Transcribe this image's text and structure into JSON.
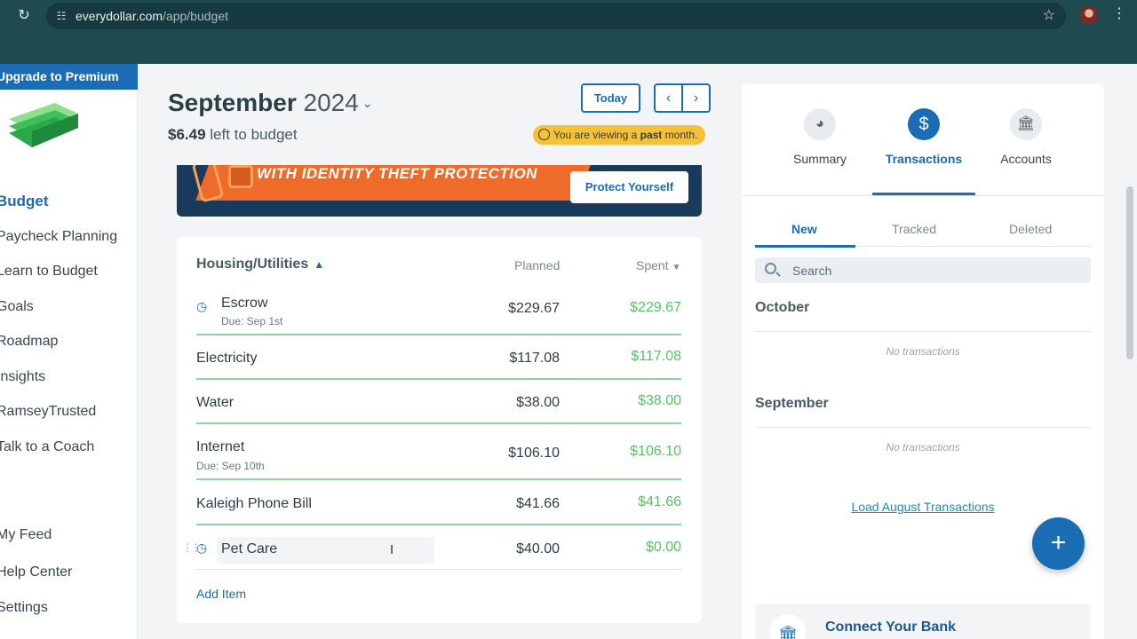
{
  "browser": {
    "url_host": "everydollar.com",
    "url_path": "/app/budget"
  },
  "sidebar": {
    "premium_label": "Upgrade to Premium",
    "items": [
      {
        "label": "Budget"
      },
      {
        "label": "Paycheck Planning"
      },
      {
        "label": "Learn to Budget"
      },
      {
        "label": "Goals"
      },
      {
        "label": "Roadmap"
      },
      {
        "label": "Insights"
      },
      {
        "label": "RamseyTrusted"
      },
      {
        "label": "Talk to a Coach"
      },
      {
        "label": "My Feed"
      },
      {
        "label": "Help Center"
      },
      {
        "label": "Settings"
      }
    ]
  },
  "header": {
    "month": "September",
    "year": "2024",
    "left_amount": "$6.49",
    "left_label": "left to budget",
    "today_label": "Today",
    "past_prefix": "You are viewing a ",
    "past_word": "past",
    "past_suffix": " month."
  },
  "banner": {
    "text": "WITH IDENTITY THEFT PROTECTION",
    "button_label": "Protect Yourself"
  },
  "budget_group": {
    "title": "Housing/Utilities",
    "planned_header": "Planned",
    "spent_header": "Spent",
    "add_item_label": "Add Item",
    "rows": [
      {
        "name": "Escrow",
        "due": "Due: Sep 1st",
        "planned": "$229.67",
        "spent": "$229.67"
      },
      {
        "name": "Electricity",
        "planned": "$117.08",
        "spent": "$117.08"
      },
      {
        "name": "Water",
        "planned": "$38.00",
        "spent": "$38.00"
      },
      {
        "name": "Internet",
        "due": "Due: Sep 10th",
        "planned": "$106.10",
        "spent": "$106.10"
      },
      {
        "name": "Kaleigh Phone Bill",
        "planned": "$41.66",
        "spent": "$41.66"
      },
      {
        "name": "Pet Care",
        "planned": "$40.00",
        "spent": "$0.00"
      }
    ]
  },
  "panel": {
    "tabs": [
      {
        "label": "Summary",
        "icon": "pie-chart-icon"
      },
      {
        "label": "Transactions",
        "icon": "dollar-icon"
      },
      {
        "label": "Accounts",
        "icon": "bank-icon"
      }
    ],
    "subtabs": [
      {
        "label": "New"
      },
      {
        "label": "Tracked"
      },
      {
        "label": "Deleted"
      }
    ],
    "search_placeholder": "Search",
    "sections": [
      {
        "month": "October",
        "empty": "No transactions"
      },
      {
        "month": "September",
        "empty": "No transactions"
      }
    ],
    "load_link": "Load August Transactions",
    "connect_label": "Connect Your Bank"
  },
  "colors": {
    "brand_blue": "#1a6cb5",
    "spent_green": "#52c463",
    "past_badge": "#f3c13a",
    "chrome": "#1f4a50"
  }
}
